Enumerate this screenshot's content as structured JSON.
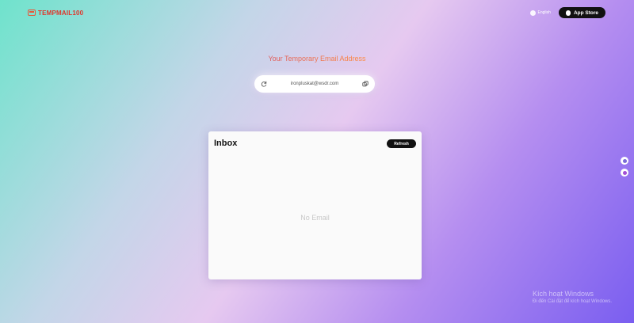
{
  "header": {
    "logo_text": "TEMPMAIL100",
    "language_label": "English",
    "app_store_label": "App Store"
  },
  "main": {
    "heading": "Your Temporary Email Address",
    "email_address": "ironpluskat@wsdr.com"
  },
  "inbox": {
    "title": "Inbox",
    "refresh_label": "Refresh",
    "empty_text": "No Email"
  },
  "watermark": {
    "line1": "Kích hoạt Windows",
    "line2": "Đi đến Cài đặt để kích hoạt Windows."
  },
  "colors": {
    "heading_gradient_start": "#e05a5a",
    "heading_gradient_end": "#ff8a3d",
    "logo_color": "#e0352b",
    "button_dark": "#111111"
  }
}
